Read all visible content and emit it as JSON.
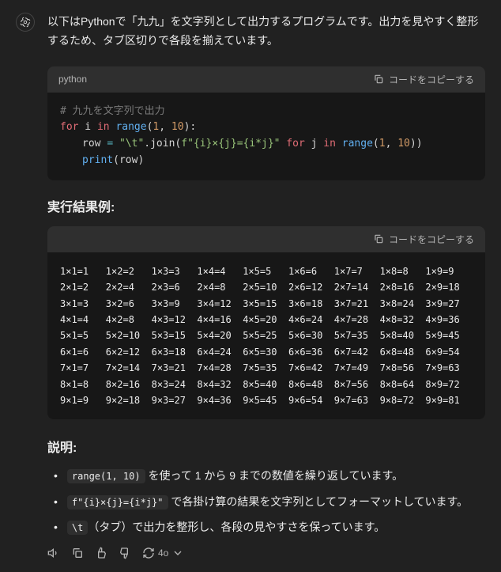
{
  "intro": "以下はPythonで「九九」を文字列として出力するプログラムです。出力を見やすく整形するため、タブ区切りで各段を揃えています。",
  "code": {
    "lang": "python",
    "copy_label": "コードをコピーする",
    "comment": "# 九九を文字列で出力",
    "kw_for1": "for",
    "var_i": " i ",
    "kw_in1": "in",
    "range1": " range",
    "paren1": "(",
    "n1": "1",
    "comma": ", ",
    "n10": "10",
    "paren2": "):",
    "row_var": "row ",
    "eq": "= ",
    "tab_str": "\"\\t\"",
    "join": ".join(",
    "fstr": "f\"{i}×{j}={i*j}\"",
    "kw_for2": " for",
    "var_j": " j ",
    "kw_in2": "in",
    "range2": " range",
    "paren3": "(",
    "n1b": "1",
    "n10b": "10",
    "paren4": "))",
    "print": "print",
    "print_arg": "(row)"
  },
  "result_heading": "実行結果例:",
  "output_copy": "コードをコピーする",
  "explain_heading": "説明:",
  "bullets": [
    {
      "code": "range(1, 10)",
      "text": " を使って 1 から 9 までの数値を繰り返しています。"
    },
    {
      "code": "f\"{i}×{j}={i*j}\"",
      "text": " で各掛け算の結果を文字列としてフォーマットしています。"
    },
    {
      "code": "\\t",
      "text": "（タブ）で出力を整形し、各段の見やすさを保っています。"
    }
  ],
  "model_label": "4o",
  "chart_data": {
    "type": "table",
    "title": "九九 multiplication table output",
    "rows": [
      [
        "1×1=1",
        "1×2=2",
        "1×3=3",
        "1×4=4",
        "1×5=5",
        "1×6=6",
        "1×7=7",
        "1×8=8",
        "1×9=9"
      ],
      [
        "2×1=2",
        "2×2=4",
        "2×3=6",
        "2×4=8",
        "2×5=10",
        "2×6=12",
        "2×7=14",
        "2×8=16",
        "2×9=18"
      ],
      [
        "3×1=3",
        "3×2=6",
        "3×3=9",
        "3×4=12",
        "3×5=15",
        "3×6=18",
        "3×7=21",
        "3×8=24",
        "3×9=27"
      ],
      [
        "4×1=4",
        "4×2=8",
        "4×3=12",
        "4×4=16",
        "4×5=20",
        "4×6=24",
        "4×7=28",
        "4×8=32",
        "4×9=36"
      ],
      [
        "5×1=5",
        "5×2=10",
        "5×3=15",
        "5×4=20",
        "5×5=25",
        "5×6=30",
        "5×7=35",
        "5×8=40",
        "5×9=45"
      ],
      [
        "6×1=6",
        "6×2=12",
        "6×3=18",
        "6×4=24",
        "6×5=30",
        "6×6=36",
        "6×7=42",
        "6×8=48",
        "6×9=54"
      ],
      [
        "7×1=7",
        "7×2=14",
        "7×3=21",
        "7×4=28",
        "7×5=35",
        "7×6=42",
        "7×7=49",
        "7×8=56",
        "7×9=63"
      ],
      [
        "8×1=8",
        "8×2=16",
        "8×3=24",
        "8×4=32",
        "8×5=40",
        "8×6=48",
        "8×7=56",
        "8×8=64",
        "8×9=72"
      ],
      [
        "9×1=9",
        "9×2=18",
        "9×3=27",
        "9×4=36",
        "9×5=45",
        "9×6=54",
        "9×7=63",
        "9×8=72",
        "9×9=81"
      ]
    ]
  }
}
